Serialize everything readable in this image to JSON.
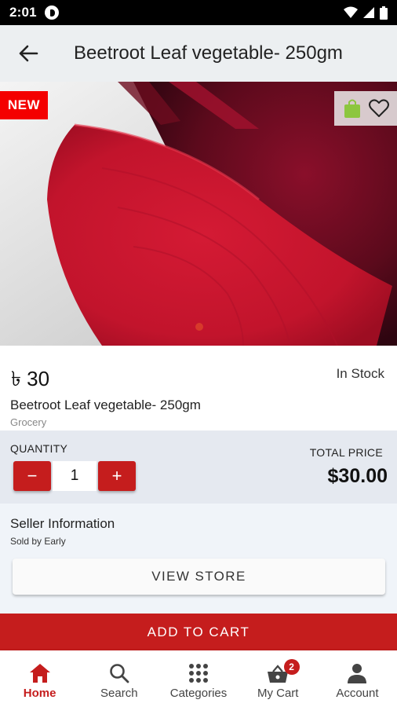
{
  "status_bar": {
    "time": "2:01"
  },
  "header": {
    "title": "Beetroot Leaf vegetable- 250gm"
  },
  "hero": {
    "badge": "NEW",
    "carousel_pages": 1,
    "carousel_active": 1
  },
  "product": {
    "price": "৳ 30",
    "stock": "In Stock",
    "name": "Beetroot Leaf vegetable- 250gm",
    "category": "Grocery"
  },
  "quantity": {
    "label": "QUANTITY",
    "value": "1",
    "minus": "−",
    "plus": "+",
    "total_label": "TOTAL PRICE",
    "total_value": "$30.00"
  },
  "seller": {
    "title": "Seller Information",
    "sold_by": "Sold by Early",
    "view_store": "VIEW STORE"
  },
  "actions": {
    "add_to_cart": "ADD TO CART"
  },
  "bottom_nav": {
    "items": [
      {
        "label": "Home",
        "icon": "home-icon",
        "active": true
      },
      {
        "label": "Search",
        "icon": "search-icon",
        "active": false
      },
      {
        "label": "Categories",
        "icon": "grid-icon",
        "active": false
      },
      {
        "label": "My Cart",
        "icon": "basket-icon",
        "active": false,
        "badge": "2"
      },
      {
        "label": "Account",
        "icon": "person-icon",
        "active": false
      }
    ]
  },
  "colors": {
    "accent": "#c51d1d",
    "new_badge": "#f40000",
    "panel": "#e5e9f0",
    "app_bar": "#eceff1"
  }
}
